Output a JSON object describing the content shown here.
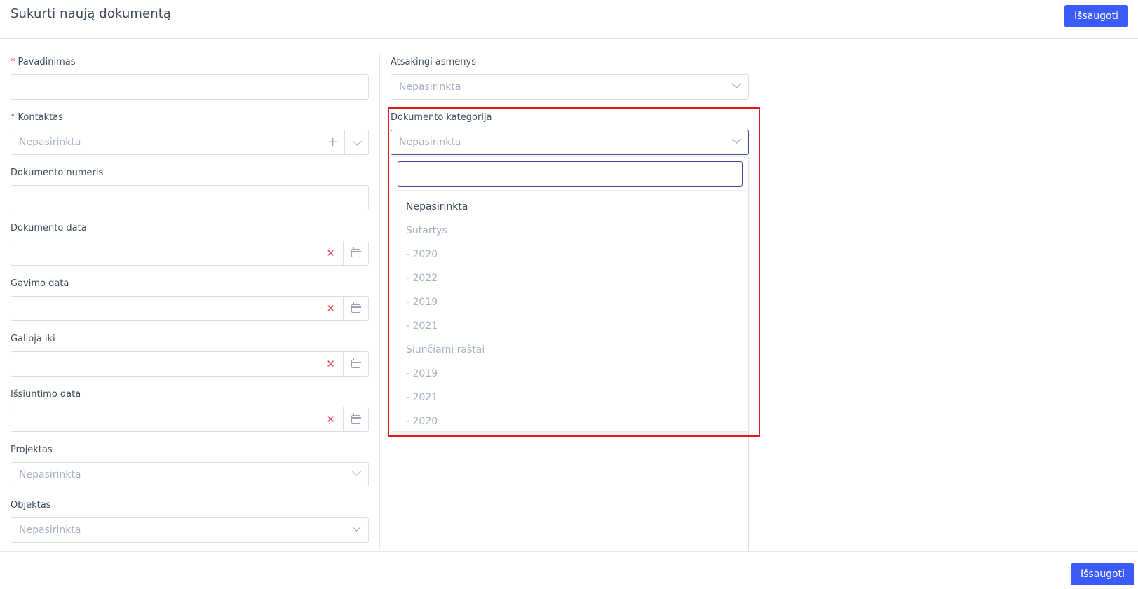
{
  "header": {
    "title": "Sukurti naują dokumentą",
    "save_label": "Išsaugoti"
  },
  "footer": {
    "save_label": "Išsaugoti"
  },
  "left": {
    "pavadinimas": {
      "label": "Pavadinimas",
      "required": true
    },
    "kontaktas": {
      "label": "Kontaktas",
      "required": true,
      "placeholder": "Nepasirinkta"
    },
    "dokumento_numeris": {
      "label": "Dokumento numeris"
    },
    "dokumento_data": {
      "label": "Dokumento data"
    },
    "gavimo_data": {
      "label": "Gavimo data"
    },
    "galioja_iki": {
      "label": "Galioja iki"
    },
    "issiuntimo_data": {
      "label": "Išsiuntimo data"
    },
    "projektas": {
      "label": "Projektas",
      "placeholder": "Nepasirinkta"
    },
    "objektas": {
      "label": "Objektas",
      "placeholder": "Nepasirinkta"
    }
  },
  "right": {
    "atsakingi": {
      "label": "Atsakingi asmenys",
      "placeholder": "Nepasirinkta"
    },
    "kategorija": {
      "label": "Dokumento kategorija",
      "placeholder": "Nepasirinkta",
      "options": [
        "Nepasirinkta",
        "Sutartys",
        "- 2020",
        "- 2022",
        "- 2019",
        "- 2021",
        "Siunčiami raštai",
        "- 2019",
        "- 2021",
        "- 2020"
      ]
    }
  },
  "icons": {
    "required": "*",
    "clear": "✕",
    "add": "+"
  },
  "colors": {
    "accent": "#3b5bfd",
    "required": "#e5484d",
    "highlight": "#e0191d"
  }
}
